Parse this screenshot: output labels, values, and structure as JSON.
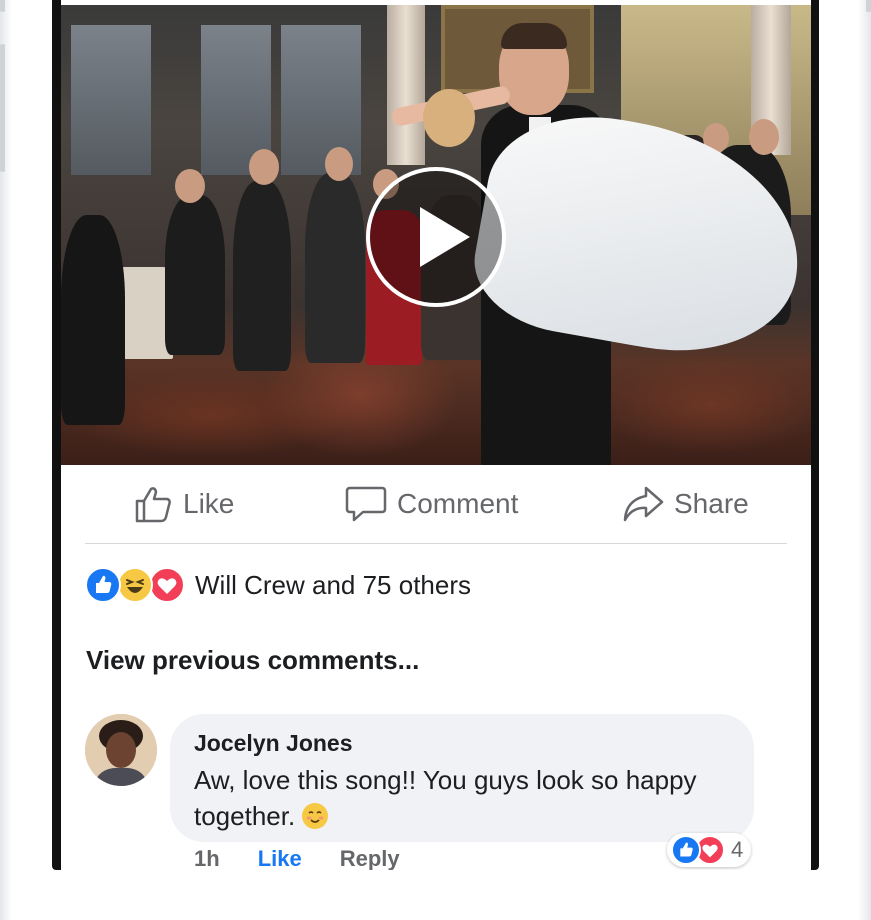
{
  "post": {
    "video": {
      "play_icon": "play-icon"
    },
    "actions": {
      "like_label": "Like",
      "comment_label": "Comment",
      "share_label": "Share"
    },
    "reactions": {
      "icons": [
        "like-reaction-icon",
        "haha-reaction-icon",
        "love-reaction-icon"
      ],
      "summary": "Will Crew and 75 others"
    },
    "view_previous_label": "View previous comments...",
    "comments": [
      {
        "author": "Jocelyn Jones",
        "text": "Aw, love this song!! You guys look so happy together.",
        "emoji": "blush-emoji",
        "reaction_icons": [
          "like-reaction-icon",
          "love-reaction-icon"
        ],
        "reaction_count": "4",
        "time": "1h",
        "like_label": "Like",
        "reply_label": "Reply"
      }
    ]
  },
  "colors": {
    "accent": "#1877f2",
    "love": "#f33e58",
    "haha": "#f7c843",
    "text": "#1c1e21",
    "secondary_text": "#65676b"
  }
}
